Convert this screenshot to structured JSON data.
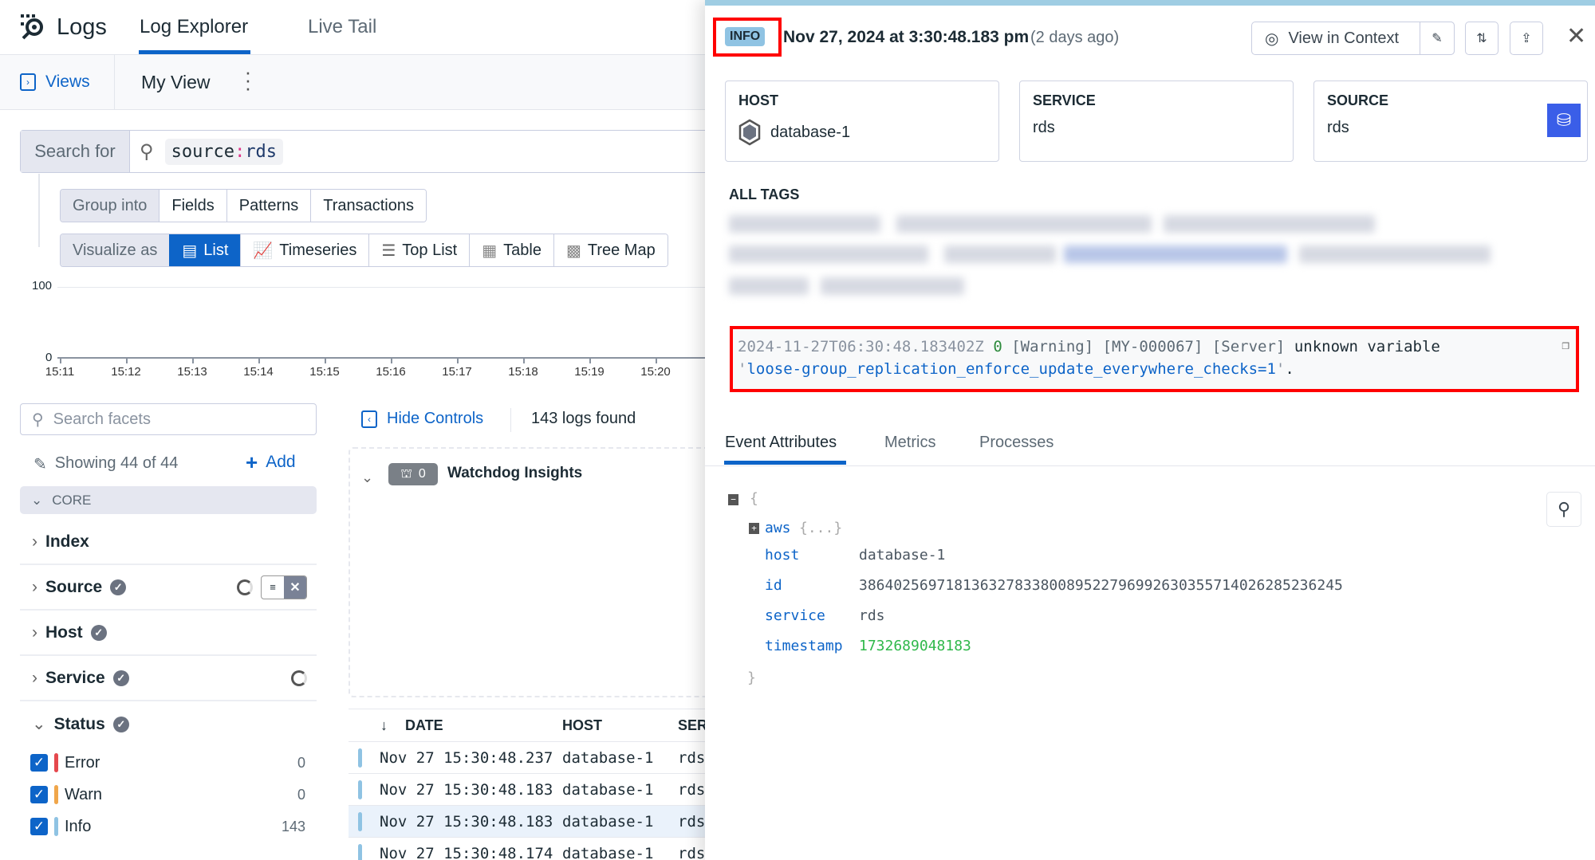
{
  "nav": {
    "app": "Logs",
    "tabs": [
      {
        "label": "Log Explorer",
        "active": true
      },
      {
        "label": "Live Tail"
      }
    ]
  },
  "views": {
    "views_label": "Views",
    "current_view": "My View"
  },
  "search": {
    "label": "Search for",
    "query_key": "source",
    "query_sep": ":",
    "query_value": "rds"
  },
  "group_into": {
    "label": "Group into",
    "options": [
      "Fields",
      "Patterns",
      "Transactions"
    ]
  },
  "visualize": {
    "label": "Visualize as",
    "options": [
      "List",
      "Timeseries",
      "Top List",
      "Table",
      "Tree Map"
    ],
    "selected": "List"
  },
  "chart_data": {
    "type": "bar",
    "y_ticks": [
      "100",
      "0"
    ],
    "ylim": [
      0,
      100
    ],
    "x_ticks": [
      "15:11",
      "15:12",
      "15:13",
      "15:14",
      "15:15",
      "15:16",
      "15:17",
      "15:18",
      "15:19",
      "15:20"
    ]
  },
  "facets": {
    "search_placeholder": "Search facets",
    "showing": "Showing 44 of 44",
    "add_label": "Add",
    "group": "CORE",
    "items": [
      "Index",
      "Source",
      "Host",
      "Service",
      "Status"
    ],
    "status": [
      {
        "label": "Error",
        "count": "0",
        "color": "#e5484d"
      },
      {
        "label": "Warn",
        "count": "0",
        "color": "#f0a64a"
      },
      {
        "label": "Info",
        "count": "143",
        "color": "#8fc3e3"
      }
    ]
  },
  "results": {
    "hide_controls": "Hide Controls",
    "count": "143 logs found",
    "watchdog_count": "0",
    "watchdog_label": "Watchdog Insights",
    "columns": [
      "DATE",
      "HOST",
      "SERVICE"
    ],
    "rows": [
      [
        "Nov 27 15:30:48.237",
        "database-1",
        "rds"
      ],
      [
        "Nov 27 15:30:48.183",
        "database-1",
        "rds"
      ],
      [
        "Nov 27 15:30:48.183",
        "database-1",
        "rds"
      ],
      [
        "Nov 27 15:30:48.174",
        "database-1",
        "rds"
      ]
    ]
  },
  "detail": {
    "status": "INFO",
    "timestamp": "Nov 27, 2024 at 3:30:48.183 pm",
    "relative": "(2 days ago)",
    "view_in_context": "View in Context",
    "host_label": "HOST",
    "host": "database-1",
    "service_label": "SERVICE",
    "service": "rds",
    "source_label": "SOURCE",
    "source": "rds",
    "all_tags": "ALL TAGS",
    "message": {
      "ts": "2024-11-27T06:30:48.183402Z",
      "thread": "0",
      "rest": " [Warning] [MY-000067] [Server] ",
      "plain": "unknown variable",
      "quote1": "'",
      "str": "loose-group_replication_enforce_update_everywhere_checks=1",
      "quote2": "'",
      "end": "."
    },
    "tabs": [
      "Event Attributes",
      "Metrics",
      "Processes"
    ],
    "json": {
      "open": "{",
      "aws_key": "aws",
      "aws_val": "{...}",
      "attrs": [
        {
          "k": "host",
          "v": "database-1"
        },
        {
          "k": "id",
          "v": "38640256971813632783380089522796992630355714026285236245"
        },
        {
          "k": "service",
          "v": "rds"
        },
        {
          "k": "timestamp",
          "v": "1732689048183"
        }
      ],
      "close": "}"
    },
    "accent": "#0d64c8",
    "highlight": "#ff0000"
  }
}
